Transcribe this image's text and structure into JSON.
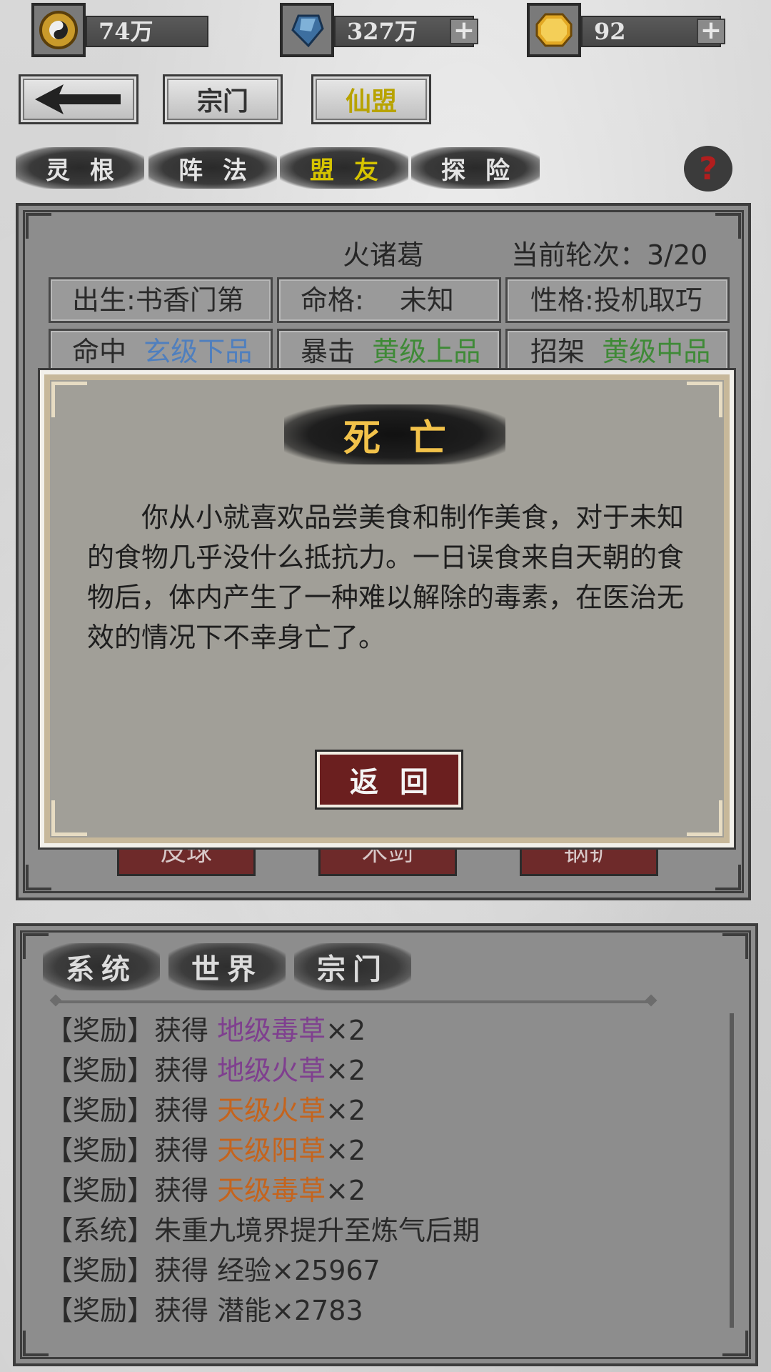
{
  "resources": [
    {
      "icon": "taiji-coin-icon",
      "value": "74万",
      "has_plus": false
    },
    {
      "icon": "blue-crystal-icon",
      "value": "327万",
      "has_plus": true
    },
    {
      "icon": "gold-gem-icon",
      "value": "92",
      "has_plus": true
    }
  ],
  "nav": {
    "back_icon": "back-arrow-icon",
    "buttons": [
      "宗门",
      "仙盟"
    ],
    "active": "仙盟"
  },
  "tabs": {
    "items": [
      "灵根",
      "阵法",
      "盟友",
      "探险"
    ],
    "active": "盟友",
    "help_label": "?"
  },
  "character": {
    "name": "火诸葛",
    "round": "当前轮次：3/20",
    "attributes_row1": [
      {
        "label": "出生:",
        "value": "书香门第"
      },
      {
        "label": "命格:",
        "value": "未知"
      },
      {
        "label": "性格:",
        "value": "投机取巧"
      }
    ],
    "attributes_row2": [
      {
        "label": "命中",
        "value": "玄级下品",
        "color": "#4f7fbe"
      },
      {
        "label": "暴击",
        "value": "黄级上品",
        "color": "#3f8a37"
      },
      {
        "label": "招架",
        "value": "黄级中品",
        "color": "#3f8a37"
      }
    ],
    "hidden_buttons": [
      "皮球",
      "木剑",
      "钢铲"
    ]
  },
  "modal": {
    "title": "死亡",
    "text": "你从小就喜欢品尝美食和制作美食，对于未知的食物几乎没什么抵抗力。一日误食来自天朝的食物后，体内产生了一种难以解除的毒素，在医治无效的情况下不幸身亡了。",
    "button": "返回"
  },
  "log": {
    "tabs": [
      "系统",
      "世界",
      "宗门"
    ],
    "lines": [
      {
        "tag": "【奖励】",
        "prefix": "获得 ",
        "item": "地级毒草",
        "item_color": "purple",
        "suffix": "×2"
      },
      {
        "tag": "【奖励】",
        "prefix": "获得 ",
        "item": "地级火草",
        "item_color": "purple",
        "suffix": "×2"
      },
      {
        "tag": "【奖励】",
        "prefix": "获得 ",
        "item": "天级火草",
        "item_color": "orange",
        "suffix": "×2"
      },
      {
        "tag": "【奖励】",
        "prefix": "获得 ",
        "item": "天级阳草",
        "item_color": "orange",
        "suffix": "×2"
      },
      {
        "tag": "【奖励】",
        "prefix": "获得 ",
        "item": "天级毒草",
        "item_color": "orange",
        "suffix": "×2"
      },
      {
        "tag": "【系统】",
        "prefix": "朱重九境界提升至炼气后期",
        "item": "",
        "item_color": "",
        "suffix": ""
      },
      {
        "tag": "【奖励】",
        "prefix": "获得 经验",
        "item": "",
        "item_color": "",
        "suffix": "×25967"
      },
      {
        "tag": "【奖励】",
        "prefix": "获得 潜能",
        "item": "",
        "item_color": "",
        "suffix": "×2783"
      }
    ]
  }
}
